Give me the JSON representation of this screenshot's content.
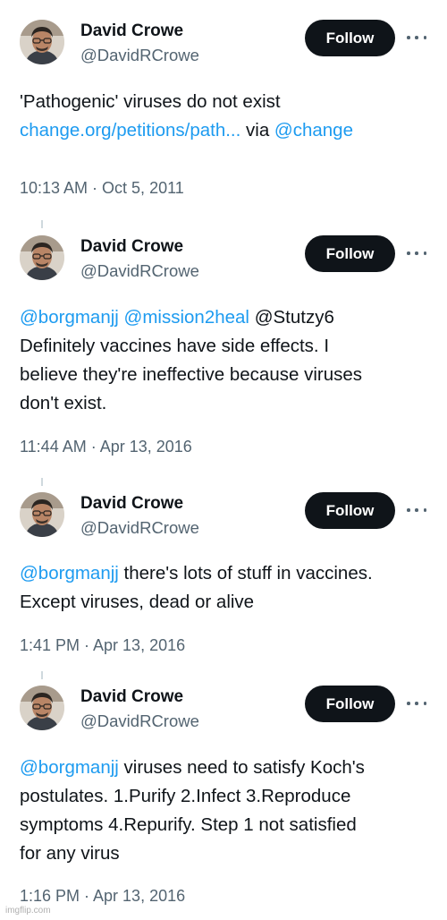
{
  "tweets": [
    {
      "author": "David Crowe",
      "handle": "@DavidRCrowe",
      "follow_label": "Follow",
      "lines": [
        [
          {
            "t": "'Pathogenic' viruses do not exist",
            "link": false
          }
        ],
        [
          {
            "t": "change.org/petitions/path...",
            "link": true
          },
          {
            "t": " via ",
            "link": false
          },
          {
            "t": "@change",
            "link": true
          }
        ]
      ],
      "timestamp": "10:13 AM · Oct 5, 2011"
    },
    {
      "author": "David Crowe",
      "handle": "@DavidRCrowe",
      "follow_label": "Follow",
      "lines": [
        [
          {
            "t": "@borgmanjj",
            "link": true
          },
          {
            "t": " ",
            "link": false
          },
          {
            "t": "@mission2heal",
            "link": true
          },
          {
            "t": " @Stutzy6",
            "link": false
          }
        ],
        [
          {
            "t": "Definitely vaccines have side effects. I",
            "link": false
          }
        ],
        [
          {
            "t": "believe they're ineffective because viruses",
            "link": false
          }
        ],
        [
          {
            "t": "don't exist.",
            "link": false
          }
        ]
      ],
      "timestamp": "11:44 AM · Apr 13, 2016"
    },
    {
      "author": "David Crowe",
      "handle": "@DavidRCrowe",
      "follow_label": "Follow",
      "lines": [
        [
          {
            "t": "@borgmanjj",
            "link": true
          },
          {
            "t": " there's lots of stuff in vaccines.",
            "link": false
          }
        ],
        [
          {
            "t": "Except viruses, dead or alive",
            "link": false
          }
        ]
      ],
      "timestamp": "1:41 PM · Apr 13, 2016"
    },
    {
      "author": "David Crowe",
      "handle": "@DavidRCrowe",
      "follow_label": "Follow",
      "lines": [
        [
          {
            "t": "@borgmanjj",
            "link": true
          },
          {
            "t": " viruses need to satisfy Koch's",
            "link": false
          }
        ],
        [
          {
            "t": "postulates. 1.Purify 2.Infect 3.Reproduce",
            "link": false
          }
        ],
        [
          {
            "t": "symptoms 4.Repurify. Step 1 not satisfied",
            "link": false
          }
        ],
        [
          {
            "t": "for any virus",
            "link": false
          }
        ]
      ],
      "timestamp": "1:16 PM · Apr 13, 2016"
    }
  ],
  "watermark": "imgflip.com",
  "colors": {
    "link": "#1d9bf0",
    "text": "#0f1419",
    "muted": "#536471",
    "button": "#0f1419"
  },
  "icons": {
    "more": "more-horizontal-icon",
    "avatar": "profile-photo"
  }
}
